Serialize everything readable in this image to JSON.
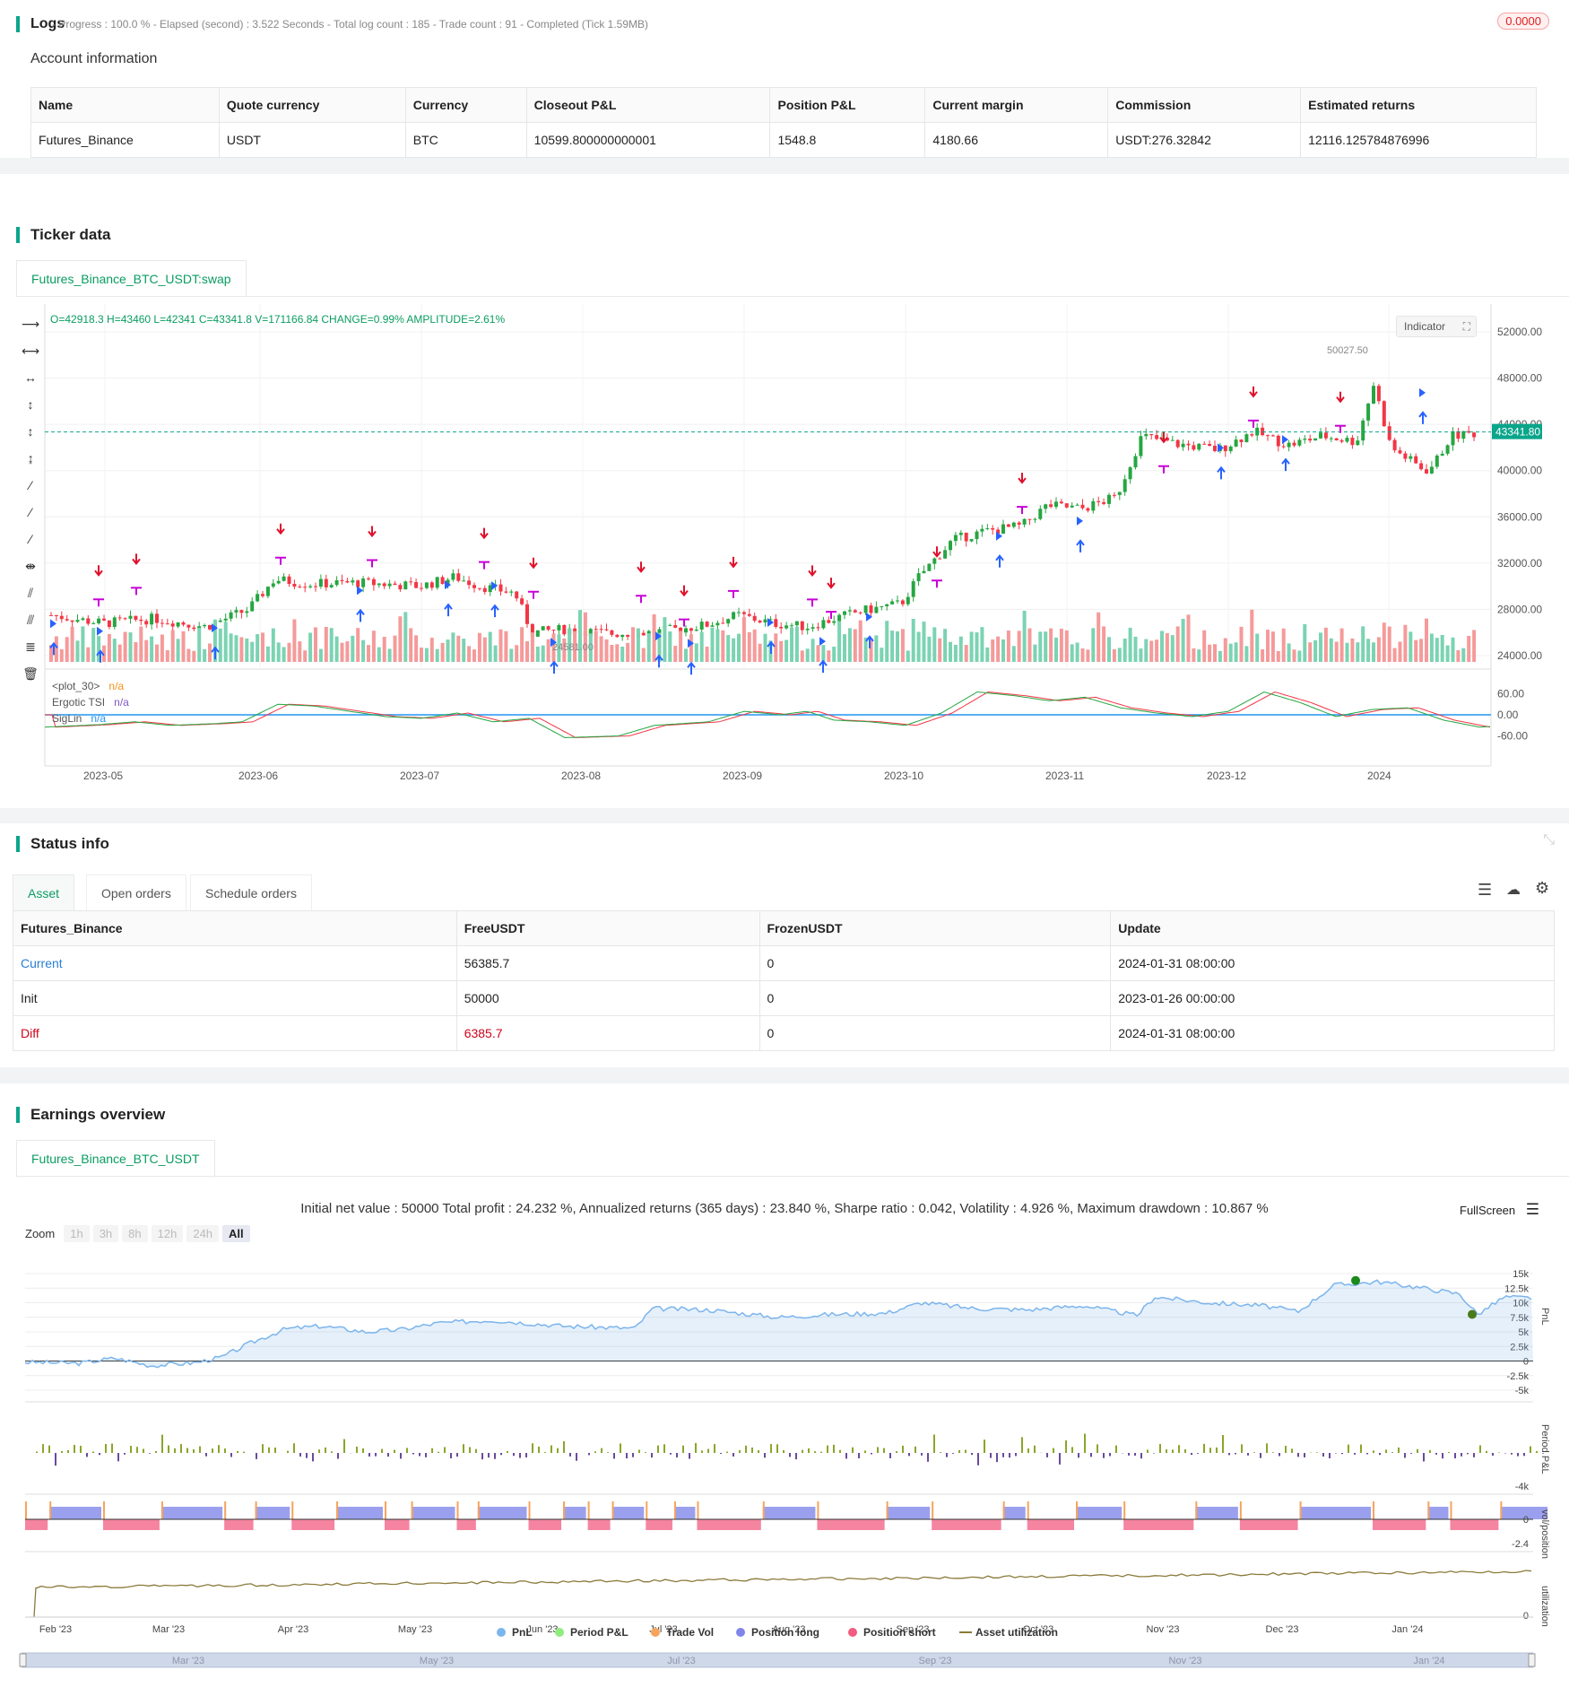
{
  "logs": {
    "title": "Logs",
    "status": "- Progress : 100.0 % - Elapsed (second) : 3.522 Seconds - Total log count : 185 - Trade count : 91 - Completed (Tick 1.59MB)",
    "badge": "0.0000"
  },
  "account": {
    "heading": "Account information",
    "columns": [
      "Name",
      "Quote currency",
      "Currency",
      "Closeout P&L",
      "Position P&L",
      "Current margin",
      "Commission",
      "Estimated returns"
    ],
    "row": [
      "Futures_Binance",
      "USDT",
      "BTC",
      "10599.800000000001",
      "1548.8",
      "4180.66",
      "USDT:276.32842",
      "12116.125784876996"
    ]
  },
  "ticker": {
    "heading": "Ticker data",
    "tab": "Futures_Binance_BTC_USDT:swap",
    "ohlc": "O=42918.3 H=43460 L=42341 C=43341.8 V=171166.84 CHANGE=0.99% AMPLITUDE=2.61%",
    "indicator_button": "Indicator",
    "price_tag": "43341.80",
    "price_levels": [
      "52000.00",
      "48000.00",
      "44000.00",
      "40000.00",
      "36000.00",
      "32000.00",
      "28000.00",
      "24000.00"
    ],
    "osc_levels": [
      "60.00",
      "0.00",
      "-60.00"
    ],
    "x_labels": [
      "2023-05",
      "2023-06",
      "2023-07",
      "2023-08",
      "2023-09",
      "2023-10",
      "2023-11",
      "2023-12",
      "2024"
    ],
    "legend": [
      {
        "name": "<plot_30>",
        "value": "n/a",
        "color": "#f7931a"
      },
      {
        "name": "Ergotic TSI",
        "value": "n/a",
        "color": "#7e57c2"
      },
      {
        "name": "SigLin",
        "value": "n/a",
        "color": "#2196f3"
      }
    ],
    "annotations": {
      "high_label": "50027.50",
      "low_label": "24581.00"
    },
    "colors": {
      "up": "#26a641",
      "down": "#f23645",
      "short_marker": "#e0102b",
      "long_marker": "#2862ff",
      "close_marker": "#c800d8"
    }
  },
  "status": {
    "heading": "Status info",
    "tabs": [
      "Asset",
      "Open orders",
      "Schedule orders"
    ],
    "columns": [
      "Futures_Binance",
      "FreeUSDT",
      "FrozenUSDT",
      "Update"
    ],
    "rows": [
      [
        "Current",
        "56385.7",
        "0",
        "2024-01-31 08:00:00"
      ],
      [
        "Init",
        "50000",
        "0",
        "2023-01-26 00:00:00"
      ],
      [
        "Diff",
        "6385.7",
        "0",
        "2024-01-31 08:00:00"
      ]
    ]
  },
  "earnings": {
    "heading": "Earnings overview",
    "tab": "Futures_Binance_BTC_USDT",
    "summary": "Initial net value : 50000 Total profit : 24.232 %, Annualized returns (365 days) : 23.840 %, Sharpe ratio : 0.042, Volatility : 4.926 %, Maximum drawdown : 10.867 %",
    "fullscreen": "FullScreen",
    "zoom_label": "Zoom",
    "zoom_options": [
      "1h",
      "3h",
      "8h",
      "12h",
      "24h",
      "All"
    ],
    "pnl_axis": [
      "15k",
      "12.5k",
      "10k",
      "7.5k",
      "5k",
      "2.5k",
      "0",
      "-2.5k",
      "-5k"
    ],
    "period_axis": [
      "-4k"
    ],
    "vol_axis": [
      "0",
      "-2.4"
    ],
    "util_axis": [
      "0"
    ],
    "axis_titles": [
      "PnL",
      "Period P&L",
      "vol/position",
      "utilization"
    ],
    "x_labels": [
      "Feb '23",
      "Mar '23",
      "Apr '23",
      "May '23",
      "Jun '23",
      "Jul '23",
      "Aug '23",
      "Sep '23",
      "Oct '23",
      "Nov '23",
      "Dec '23",
      "Jan '24"
    ],
    "navigator_labels": [
      "Mar '23",
      "May '23",
      "Jul '23",
      "Sep '23",
      "Nov '23",
      "Jan '24"
    ],
    "legend": [
      {
        "name": "PnL",
        "color": "#7cb5ec"
      },
      {
        "name": "Period P&L",
        "color": "#90ed7d"
      },
      {
        "name": "Trade Vol",
        "color": "#f7a35c"
      },
      {
        "name": "Position long",
        "color": "#8085e9"
      },
      {
        "name": "Position short",
        "color": "#f15c80"
      },
      {
        "name": "Asset utilization",
        "color": "#8a7a3a"
      }
    ]
  }
}
